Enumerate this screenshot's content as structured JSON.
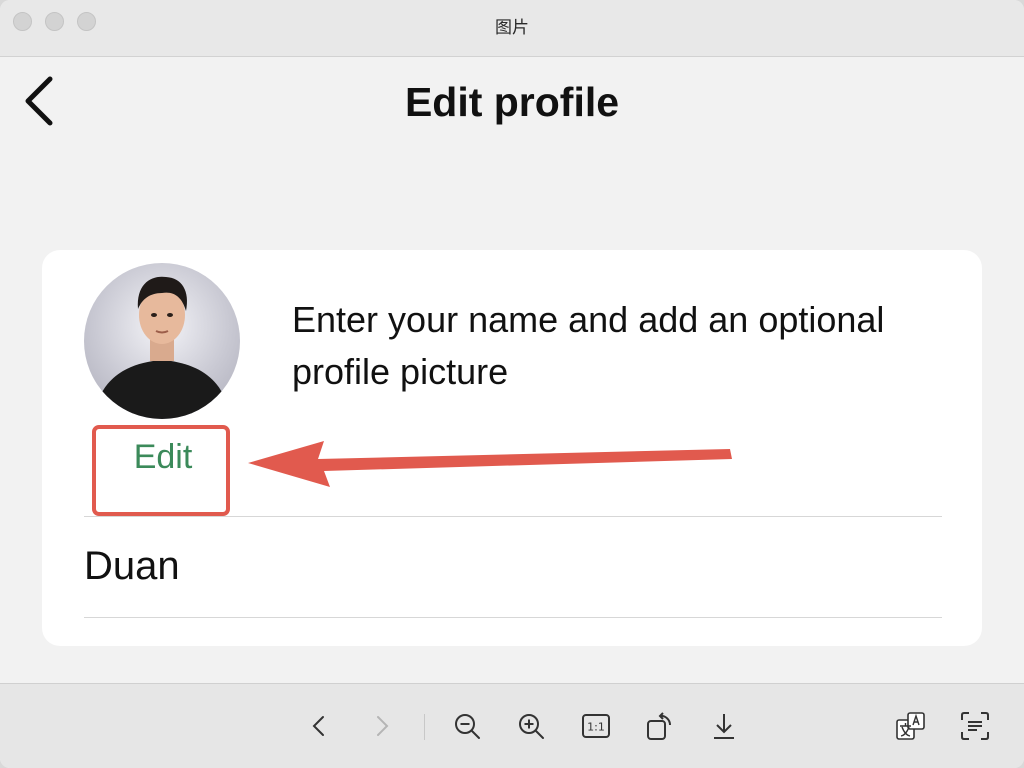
{
  "window": {
    "title": "图片"
  },
  "page": {
    "title": "Edit profile"
  },
  "profile": {
    "description": "Enter your name and add an optional profile picture",
    "edit_label": "Edit",
    "name_value": "Duan"
  },
  "icons": {
    "back": "chevron-left-icon",
    "prev": "chevron-left-icon",
    "next": "chevron-right-icon",
    "zoom_out": "zoom-out-icon",
    "zoom_in": "zoom-in-icon",
    "actual_size": "actual-size-icon",
    "rotate": "rotate-icon",
    "download": "download-icon",
    "translate": "translate-icon",
    "text_recognition": "text-recognition-icon"
  },
  "toolbar": {
    "actual_size_label": "1:1"
  },
  "colors": {
    "accent_green": "#3b8a5a",
    "annotation_red": "#e15a4e"
  }
}
